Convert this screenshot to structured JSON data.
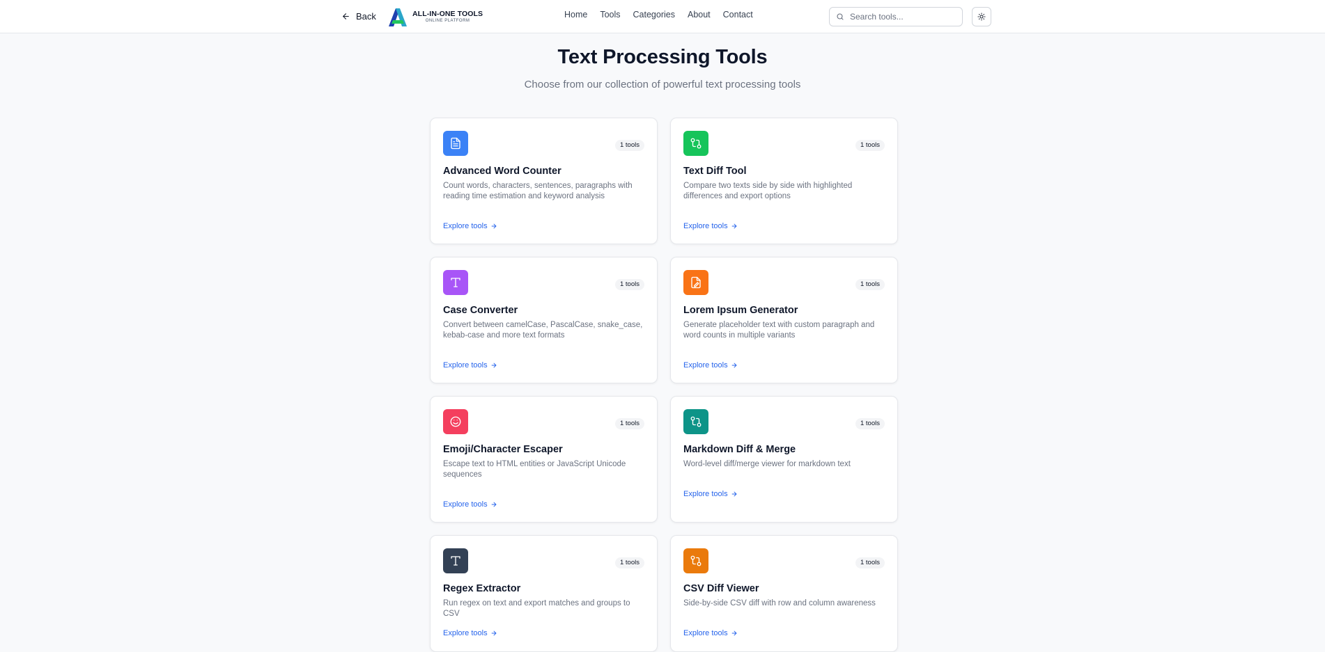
{
  "header": {
    "back_label": "Back",
    "logo_main": "ALL-IN-ONE TOOLS",
    "logo_sub": "ONLINE PLATFORM",
    "nav": [
      "Home",
      "Tools",
      "Categories",
      "About",
      "Contact"
    ],
    "search_placeholder": "Search tools...",
    "theme_icon": "sun-icon"
  },
  "hero": {
    "title": "Text Processing Tools",
    "subtitle": "Choose from our collection of powerful text processing tools"
  },
  "cards": [
    {
      "title": "Advanced Word Counter",
      "desc": "Count words, characters, sentences, paragraphs with reading time estimation and keyword analysis",
      "badge": "1 tools",
      "link": "Explore tools",
      "icon": "file-text-icon",
      "color": "#3b82f6"
    },
    {
      "title": "Text Diff Tool",
      "desc": "Compare two texts side by side with highlighted differences and export options",
      "badge": "1 tools",
      "link": "Explore tools",
      "icon": "git-compare-icon",
      "color": "#16c45a"
    },
    {
      "title": "Case Converter",
      "desc": "Convert between camelCase, PascalCase, snake_case, kebab-case and more text formats",
      "badge": "1 tools",
      "link": "Explore tools",
      "icon": "type-icon",
      "color": "#a855f7"
    },
    {
      "title": "Lorem Ipsum Generator",
      "desc": "Generate placeholder text with custom paragraph and word counts in multiple variants",
      "badge": "1 tools",
      "link": "Explore tools",
      "icon": "file-edit-icon",
      "color": "#f97316"
    },
    {
      "title": "Emoji/Character Escaper",
      "desc": "Escape text to HTML entities or JavaScript Unicode sequences",
      "badge": "1 tools",
      "link": "Explore tools",
      "icon": "smile-icon",
      "color": "#f43f5e"
    },
    {
      "title": "Markdown Diff & Merge",
      "desc": "Word-level diff/merge viewer for markdown text",
      "badge": "1 tools",
      "link": "Explore tools",
      "icon": "git-compare-icon",
      "color": "#0d9488"
    },
    {
      "title": "Regex Extractor",
      "desc": "Run regex on text and export matches and groups to CSV",
      "badge": "1 tools",
      "link": "Explore tools",
      "icon": "type-icon",
      "color": "#334155"
    },
    {
      "title": "CSV Diff Viewer",
      "desc": "Side-by-side CSV diff with row and column awareness",
      "badge": "1 tools",
      "link": "Explore tools",
      "icon": "git-compare-icon",
      "color": "#ea7a0c"
    }
  ]
}
